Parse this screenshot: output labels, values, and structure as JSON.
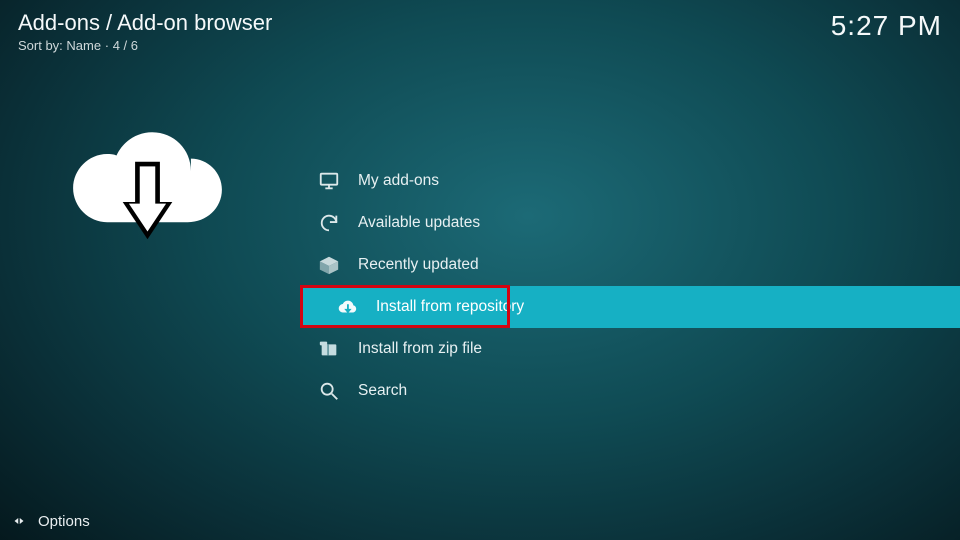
{
  "header": {
    "breadcrumb": "Add-ons / Add-on browser",
    "sort_label": "Sort by:",
    "sort_value": "Name",
    "position": "4 / 6",
    "clock": "5:27 PM"
  },
  "menu": {
    "items": [
      {
        "label": "My add-ons",
        "icon": "monitor-icon"
      },
      {
        "label": "Available updates",
        "icon": "refresh-icon"
      },
      {
        "label": "Recently updated",
        "icon": "open-box-icon"
      },
      {
        "label": "Install from repository",
        "icon": "cloud-download-icon",
        "selected": true,
        "highlighted": true
      },
      {
        "label": "Install from zip file",
        "icon": "zip-file-icon"
      },
      {
        "label": "Search",
        "icon": "search-icon"
      }
    ]
  },
  "footer": {
    "options_label": "Options"
  }
}
